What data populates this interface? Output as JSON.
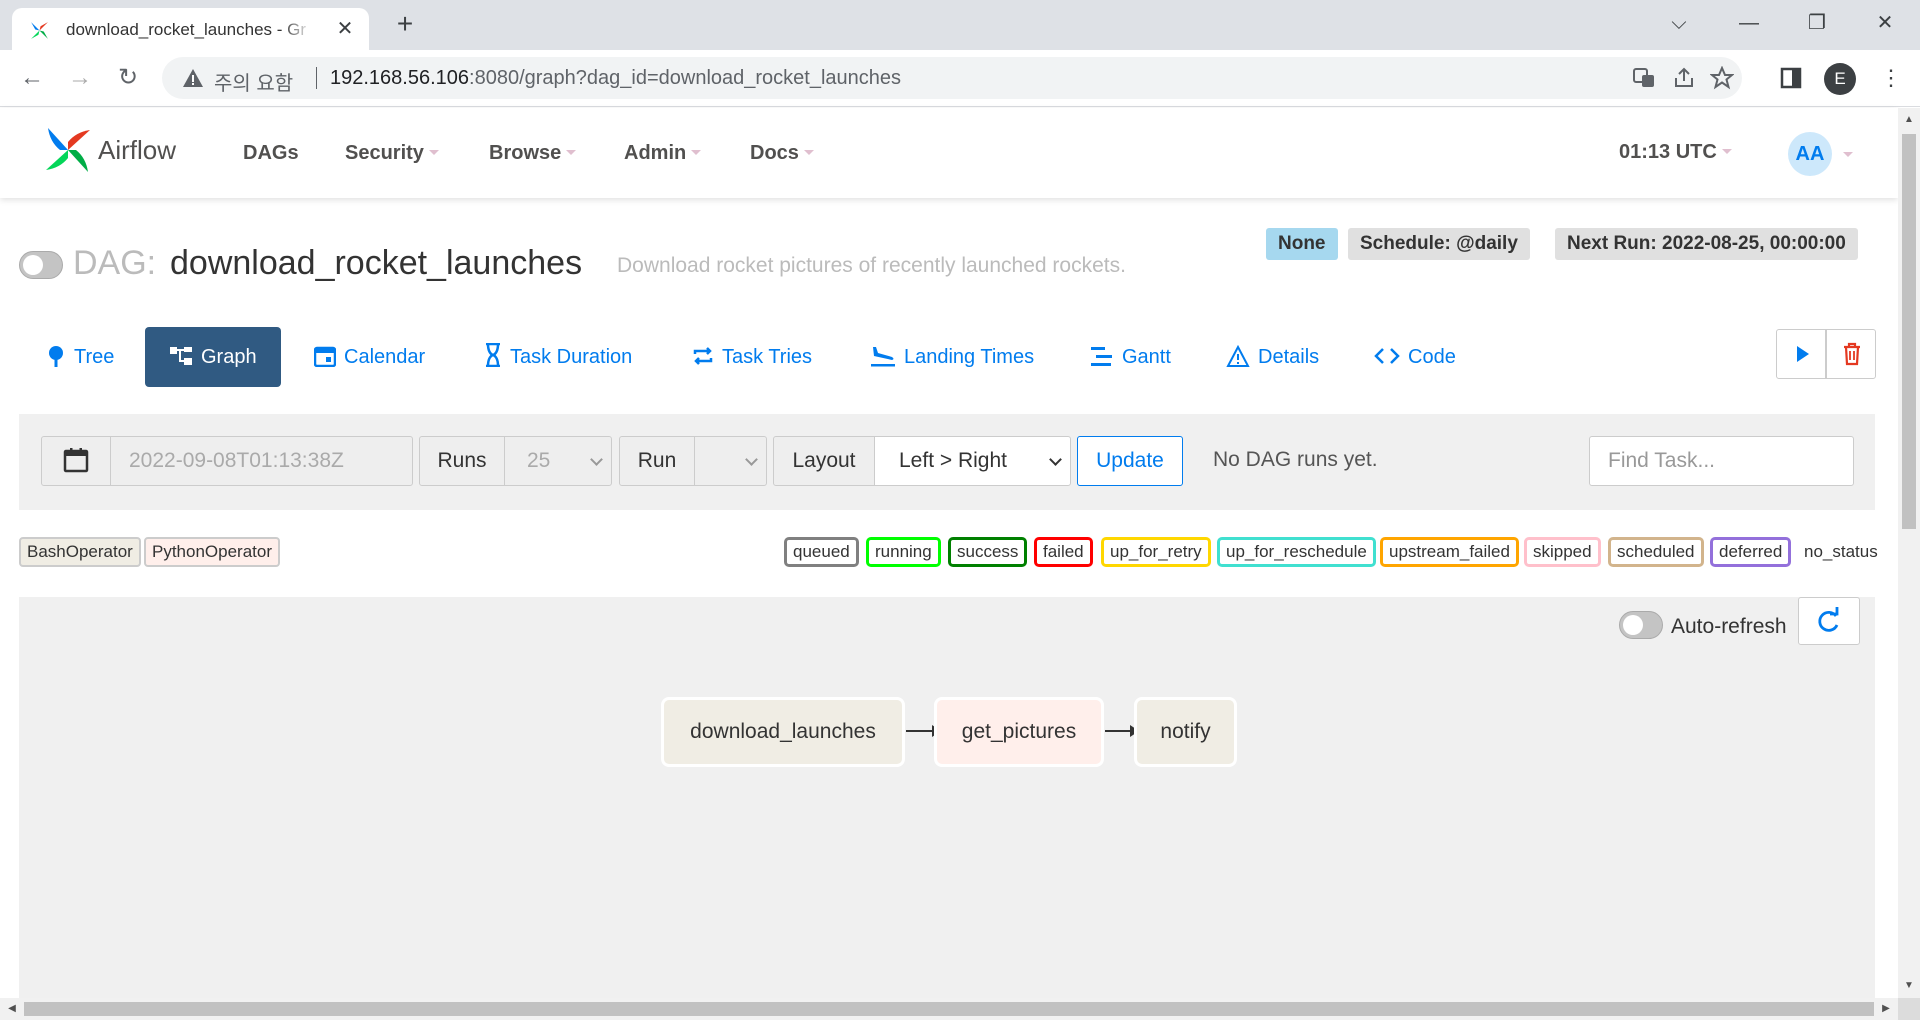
{
  "browser": {
    "tab_title": "download_rocket_launches - Graph",
    "security_warning": "주의 요함",
    "url_host": "192.168.56.106",
    "url_rest": ":8080/graph?dag_id=download_rocket_launches",
    "profile_initial": "E"
  },
  "navbar": {
    "brand": "Airflow",
    "menu": [
      "DAGs",
      "Security",
      "Browse",
      "Admin",
      "Docs"
    ],
    "time": "01:13 UTC",
    "user_initials": "AA"
  },
  "dag": {
    "prefix": "DAG:",
    "id": "download_rocket_launches",
    "description": "Download rocket pictures of recently launched rockets.",
    "labels": {
      "owner_none": "None",
      "schedule": "Schedule: @daily",
      "next_run": "Next Run: 2022-08-25, 00:00:00"
    }
  },
  "views": [
    {
      "label": "Tree",
      "icon": "tree-icon"
    },
    {
      "label": "Graph",
      "icon": "graph-icon",
      "active": true
    },
    {
      "label": "Calendar",
      "icon": "calendar-icon"
    },
    {
      "label": "Task Duration",
      "icon": "hourglass-icon"
    },
    {
      "label": "Task Tries",
      "icon": "retry-icon"
    },
    {
      "label": "Landing Times",
      "icon": "plane-landing-icon"
    },
    {
      "label": "Gantt",
      "icon": "gantt-icon"
    },
    {
      "label": "Details",
      "icon": "warning-triangle-icon"
    },
    {
      "label": "Code",
      "icon": "code-icon"
    }
  ],
  "filters": {
    "base_date": "2022-09-08T01:13:38Z",
    "runs_label": "Runs",
    "runs_value": "25",
    "run_label": "Run",
    "run_value": "",
    "layout_label": "Layout",
    "layout_value": "Left > Right",
    "update_label": "Update",
    "no_runs_message": "No DAG runs yet.",
    "find_task_placeholder": "Find Task..."
  },
  "operators": [
    {
      "name": "BashOperator",
      "color": "#f0ede4"
    },
    {
      "name": "PythonOperator",
      "color": "#ffefeb"
    }
  ],
  "states": [
    {
      "name": "queued",
      "color": "#808080"
    },
    {
      "name": "running",
      "color": "#00ff00"
    },
    {
      "name": "success",
      "color": "#008000"
    },
    {
      "name": "failed",
      "color": "#ff0000"
    },
    {
      "name": "up_for_retry",
      "color": "#ffd700"
    },
    {
      "name": "up_for_reschedule",
      "color": "#40e0d0"
    },
    {
      "name": "upstream_failed",
      "color": "#ffa500"
    },
    {
      "name": "skipped",
      "color": "#ffc0cb"
    },
    {
      "name": "scheduled",
      "color": "#d2b48c"
    },
    {
      "name": "deferred",
      "color": "#9370db"
    },
    {
      "name": "no_status",
      "color": ""
    }
  ],
  "graph": {
    "auto_refresh_label": "Auto-refresh",
    "tasks": [
      {
        "id": "download_launches",
        "operator": "BashOperator",
        "color": "#f0ede4"
      },
      {
        "id": "get_pictures",
        "operator": "PythonOperator",
        "color": "#ffefeb"
      },
      {
        "id": "notify",
        "operator": "BashOperator",
        "color": "#f0ede4"
      }
    ]
  }
}
